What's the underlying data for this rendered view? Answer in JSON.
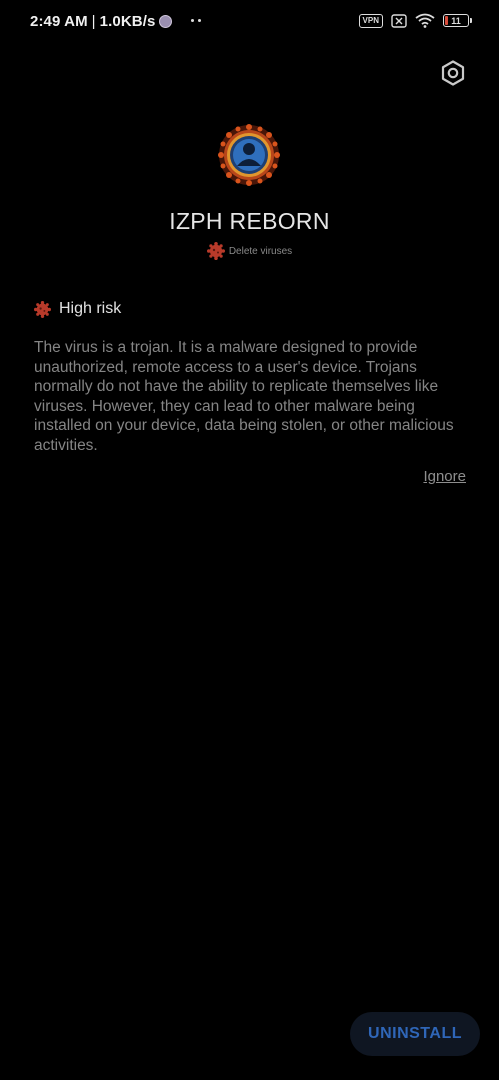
{
  "status_bar": {
    "time": "2:49 AM",
    "separator": "|",
    "speed": "1.0KB/s",
    "vpn_label": "VPN",
    "battery_level": "11",
    "icons": [
      "shield-icon",
      "vpn-icon",
      "sim-icon",
      "wifi-icon",
      "battery-icon"
    ]
  },
  "header": {
    "settings_icon": "gear-icon",
    "app_name": "IZPH REBORN",
    "subtitle": "Delete viruses"
  },
  "risk": {
    "level_label": "High risk",
    "description": "The virus is a trojan. It is a malware designed to provide unauthorized, remote access to a user's device. Trojans normally do not have the ability to replicate themselves like viruses. However, they can lead to other malware being installed on your device, data being stolen, or other malicious activities.",
    "ignore_label": "Ignore"
  },
  "actions": {
    "uninstall_label": "UNINSTALL"
  },
  "colors": {
    "background": "#000000",
    "risk_red": "#c0392b",
    "button_text": "#2f66b8",
    "button_bg": "#0f1622"
  }
}
